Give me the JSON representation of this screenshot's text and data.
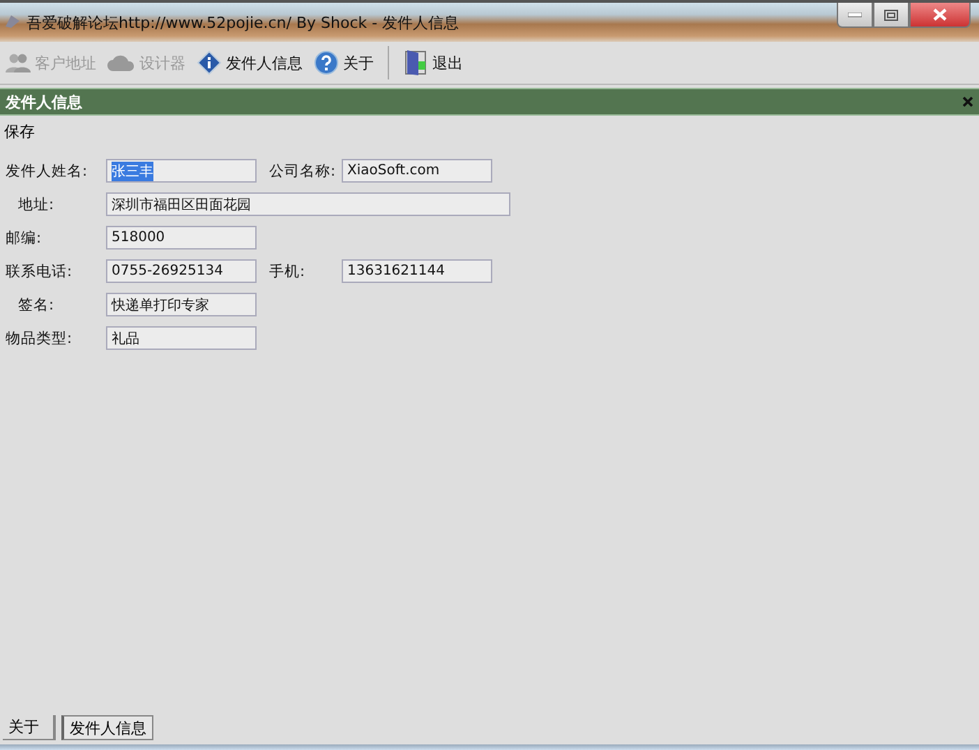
{
  "window": {
    "title": "吾爱破解论坛http://www.52pojie.cn/ By Shock - 发件人信息"
  },
  "toolbar": [
    {
      "label": "客户地址",
      "kind": "people",
      "disabled": true,
      "separated": false
    },
    {
      "label": "设计器",
      "kind": "cloud",
      "disabled": true,
      "separated": false
    },
    {
      "label": "发件人信息",
      "kind": "info",
      "disabled": false,
      "separated": false
    },
    {
      "label": "关于",
      "kind": "help",
      "disabled": false,
      "separated": false
    },
    {
      "label": "退出",
      "kind": "door",
      "disabled": false,
      "separated": true
    }
  ],
  "panel": {
    "title": "发件人信息",
    "actions": [
      "保存"
    ]
  },
  "form": [
    [
      {
        "label": "发件人姓名:",
        "value": "张三丰",
        "kind": "short",
        "selected": true
      },
      {
        "label": "公司名称:",
        "value": "XiaoSoft.com",
        "kind": "short",
        "selected": false
      }
    ],
    [
      {
        "label": "地址:",
        "value": "深圳市福田区田面花园",
        "kind": "wide",
        "selected": false
      }
    ],
    [
      {
        "label": "邮编:",
        "value": "518000",
        "kind": "short",
        "selected": false
      }
    ],
    [
      {
        "label": "联系电话:",
        "value": "0755-26925134",
        "kind": "short",
        "selected": false
      },
      {
        "label": "手机:",
        "value": "13631621144",
        "kind": "short",
        "selected": false
      }
    ],
    [
      {
        "label": "签名:",
        "value": "快递单打印专家",
        "kind": "short",
        "selected": false
      }
    ],
    [
      {
        "label": "物品类型:",
        "value": "礼品",
        "kind": "short",
        "selected": false
      }
    ]
  ],
  "bottom_tabs": [
    {
      "label": "关于",
      "selected": false
    },
    {
      "label": "发件人信息",
      "selected": true
    }
  ]
}
